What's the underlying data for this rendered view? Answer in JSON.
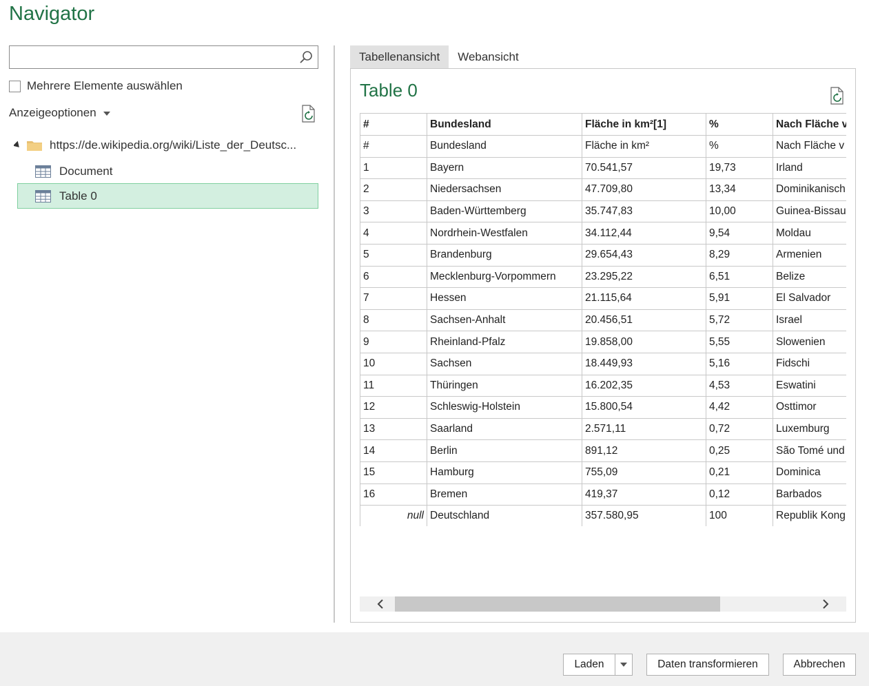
{
  "window": {
    "title": "Navigator"
  },
  "left": {
    "search": {
      "value": "",
      "placeholder": ""
    },
    "multi_select_label": "Mehrere Elemente auswählen",
    "display_options_label": "Anzeigeoptionen",
    "tree": {
      "root_label": "https://de.wikipedia.org/wiki/Liste_der_Deutsc...",
      "items": [
        {
          "label": "Document"
        },
        {
          "label": "Table 0"
        }
      ]
    }
  },
  "right": {
    "tabs": [
      {
        "label": "Tabellenansicht"
      },
      {
        "label": "Webansicht"
      }
    ],
    "preview_title": "Table 0",
    "table": {
      "headers": [
        "#",
        "Bundesland",
        "Fläche in km²[1]",
        "%",
        "Nach Fläche v"
      ],
      "rows": [
        [
          "#",
          "Bundesland",
          "Fläche in km²",
          "%",
          "Nach Fläche v"
        ],
        [
          "1",
          "Bayern",
          "70.541,57",
          "19,73",
          "Irland"
        ],
        [
          "2",
          "Niedersachsen",
          "47.709,80",
          "13,34",
          "Dominikanisch"
        ],
        [
          "3",
          "Baden-Württemberg",
          "35.747,83",
          "10,00",
          "Guinea-Bissau"
        ],
        [
          "4",
          "Nordrhein-Westfalen",
          "34.112,44",
          "9,54",
          "Moldau"
        ],
        [
          "5",
          "Brandenburg",
          "29.654,43",
          "8,29",
          "Armenien"
        ],
        [
          "6",
          "Mecklenburg-Vorpommern",
          "23.295,22",
          "6,51",
          "Belize"
        ],
        [
          "7",
          "Hessen",
          "21.115,64",
          "5,91",
          "El Salvador"
        ],
        [
          "8",
          "Sachsen-Anhalt",
          "20.456,51",
          "5,72",
          "Israel"
        ],
        [
          "9",
          "Rheinland-Pfalz",
          "19.858,00",
          "5,55",
          "Slowenien"
        ],
        [
          "10",
          "Sachsen",
          "18.449,93",
          "5,16",
          "Fidschi"
        ],
        [
          "11",
          "Thüringen",
          "16.202,35",
          "4,53",
          "Eswatini"
        ],
        [
          "12",
          "Schleswig-Holstein",
          "15.800,54",
          "4,42",
          "Osttimor"
        ],
        [
          "13",
          "Saarland",
          "2.571,11",
          "0,72",
          "Luxemburg"
        ],
        [
          "14",
          "Berlin",
          "891,12",
          "0,25",
          "São Tomé und"
        ],
        [
          "15",
          "Hamburg",
          "755,09",
          "0,21",
          "Dominica"
        ],
        [
          "16",
          "Bremen",
          "419,37",
          "0,12",
          "Barbados"
        ],
        [
          "null",
          "Deutschland",
          "357.580,95",
          "100",
          "Republik Kong"
        ]
      ]
    }
  },
  "footer": {
    "load_label": "Laden",
    "transform_label": "Daten transformieren",
    "cancel_label": "Abbrechen"
  },
  "colors": {
    "accent": "#217346",
    "selection_bg": "#d3efe0",
    "selection_border": "#7fcf9f"
  },
  "icons": [
    "search-icon",
    "refresh-icon",
    "folder-icon",
    "table-icon",
    "chevron-left-icon",
    "chevron-right-icon",
    "caret-down-icon"
  ]
}
